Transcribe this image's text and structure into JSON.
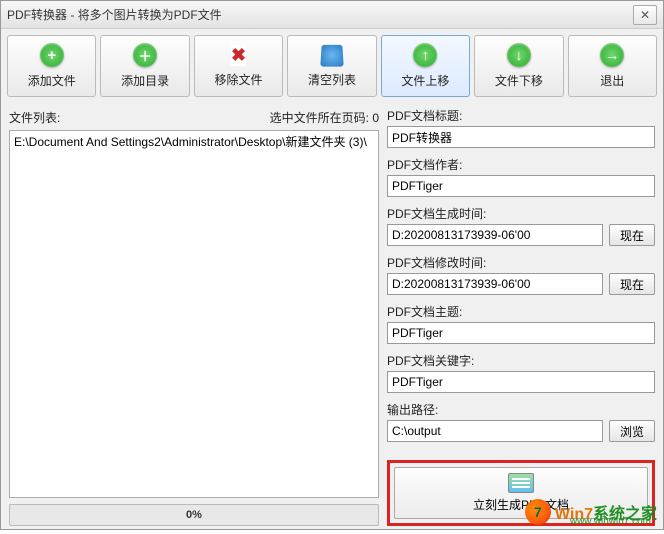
{
  "window": {
    "title": "PDF转换器 - 将多个图片转换为PDF文件"
  },
  "toolbar": {
    "add_file": "添加文件",
    "add_dir": "添加目录",
    "remove": "移除文件",
    "clear": "清空列表",
    "move_up": "文件上移",
    "move_down": "文件下移",
    "exit": "退出"
  },
  "left": {
    "list_label": "文件列表:",
    "page_label": "选中文件所在页码: 0",
    "file_item": "E:\\Document And Settings2\\Administrator\\Desktop\\新建文件夹 (3)\\",
    "progress_pct": "0%"
  },
  "right": {
    "title_label": "PDF文档标题:",
    "title_value": "PDF转换器",
    "author_label": "PDF文档作者:",
    "author_value": "PDFTiger",
    "created_label": "PDF文档生成时间:",
    "created_value": "D:20200813173939-06'00",
    "modified_label": "PDF文档修改时间:",
    "modified_value": "D:20200813173939-06'00",
    "subject_label": "PDF文档主题:",
    "subject_value": "PDFTiger",
    "keywords_label": "PDF文档关键字:",
    "keywords_value": "PDFTiger",
    "output_label": "输出路径:",
    "output_value": "C:\\output",
    "now_btn": "现在",
    "browse_btn": "浏览",
    "generate_btn": "立刻生成PDF文档"
  },
  "watermark": {
    "brand_a": "Win7",
    "brand_b": "系统之家",
    "domain": "www.winwin7.com"
  }
}
